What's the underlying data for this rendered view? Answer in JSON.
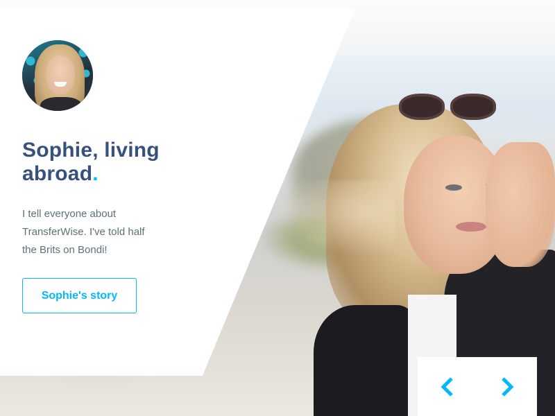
{
  "testimonial": {
    "name_line": "Sophie, living abroad",
    "title_dot": ".",
    "quote_lines": [
      "I tell everyone about",
      "TransferWise. I've told half",
      "the Brits on Bondi!"
    ],
    "button_label": "Sophie's story"
  },
  "carousel": {
    "prev_icon": "chevron-left-icon",
    "next_icon": "chevron-right-icon"
  },
  "colors": {
    "title": "#37517e",
    "accent": "#00b9ff",
    "body_text": "#5d7079",
    "card_bg": "#ffffff"
  }
}
